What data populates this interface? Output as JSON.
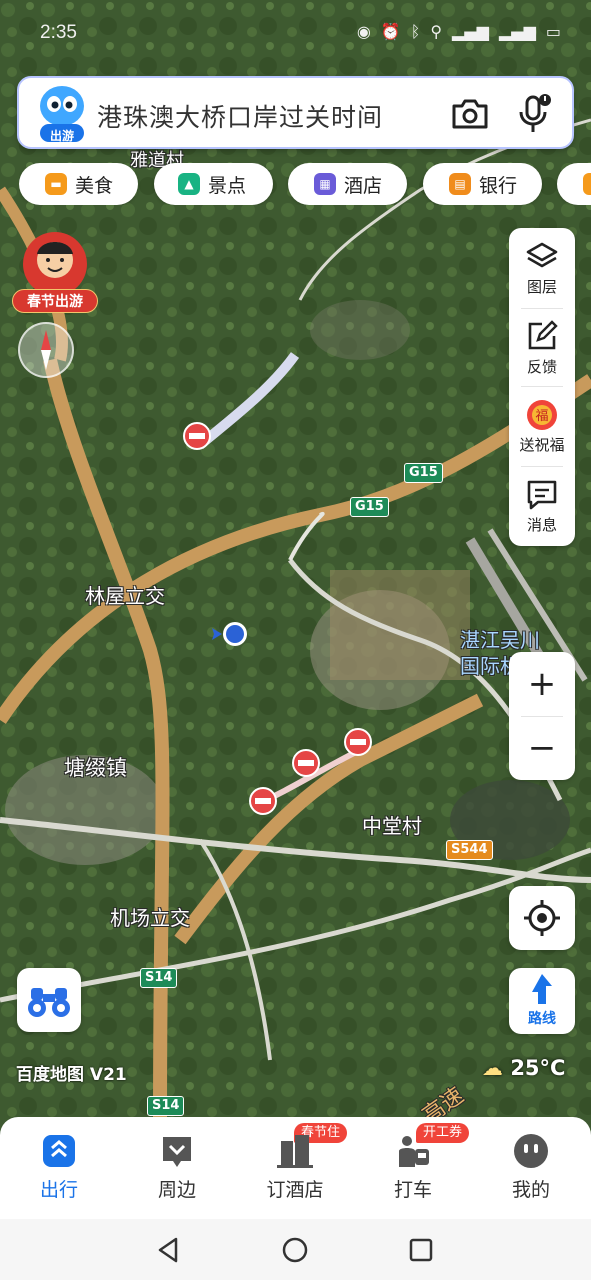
{
  "status_bar": {
    "time": "2:35"
  },
  "search": {
    "logo_label": "出游",
    "text": "港珠澳大桥口岸过关时间"
  },
  "chips": [
    {
      "label": "美食",
      "color": "#f59a1b"
    },
    {
      "label": "景点",
      "color": "#19b383"
    },
    {
      "label": "酒店",
      "color": "#6a5bd8"
    },
    {
      "label": "银行",
      "color": "#f08c1c"
    }
  ],
  "promo": {
    "label": "春节出游"
  },
  "right_panel": [
    {
      "label": "图层",
      "icon": "layers-icon"
    },
    {
      "label": "反馈",
      "icon": "feedback-icon"
    },
    {
      "label": "送祝福",
      "icon": "blessing-icon"
    },
    {
      "label": "消息",
      "icon": "message-icon"
    }
  ],
  "zoom": {
    "in": "+",
    "out": "−"
  },
  "route": {
    "label": "路线"
  },
  "map": {
    "labels": {
      "yadao": "雅道村",
      "linwu": "林屋立交",
      "tangzhui": "塘缀镇",
      "zhongtang": "中堂村",
      "jichang": "机场立交",
      "airport1": "湛江吴川",
      "airport2": "国际机场",
      "expressway": "高速"
    },
    "shields": {
      "g15a": "G15",
      "g15b": "G15",
      "s544": "S544",
      "s14a": "S14",
      "s14b": "S14"
    },
    "watermark": "百度地图 V21",
    "temperature": "25°C"
  },
  "bottom_nav": [
    {
      "label": "出行",
      "active": true
    },
    {
      "label": "周边",
      "active": false
    },
    {
      "label": "订酒店",
      "active": false,
      "badge": "春节住"
    },
    {
      "label": "打车",
      "active": false,
      "badge": "开工券"
    },
    {
      "label": "我的",
      "active": false
    }
  ],
  "colors": {
    "accent": "#1a73e8",
    "badge": "#f0443a"
  }
}
